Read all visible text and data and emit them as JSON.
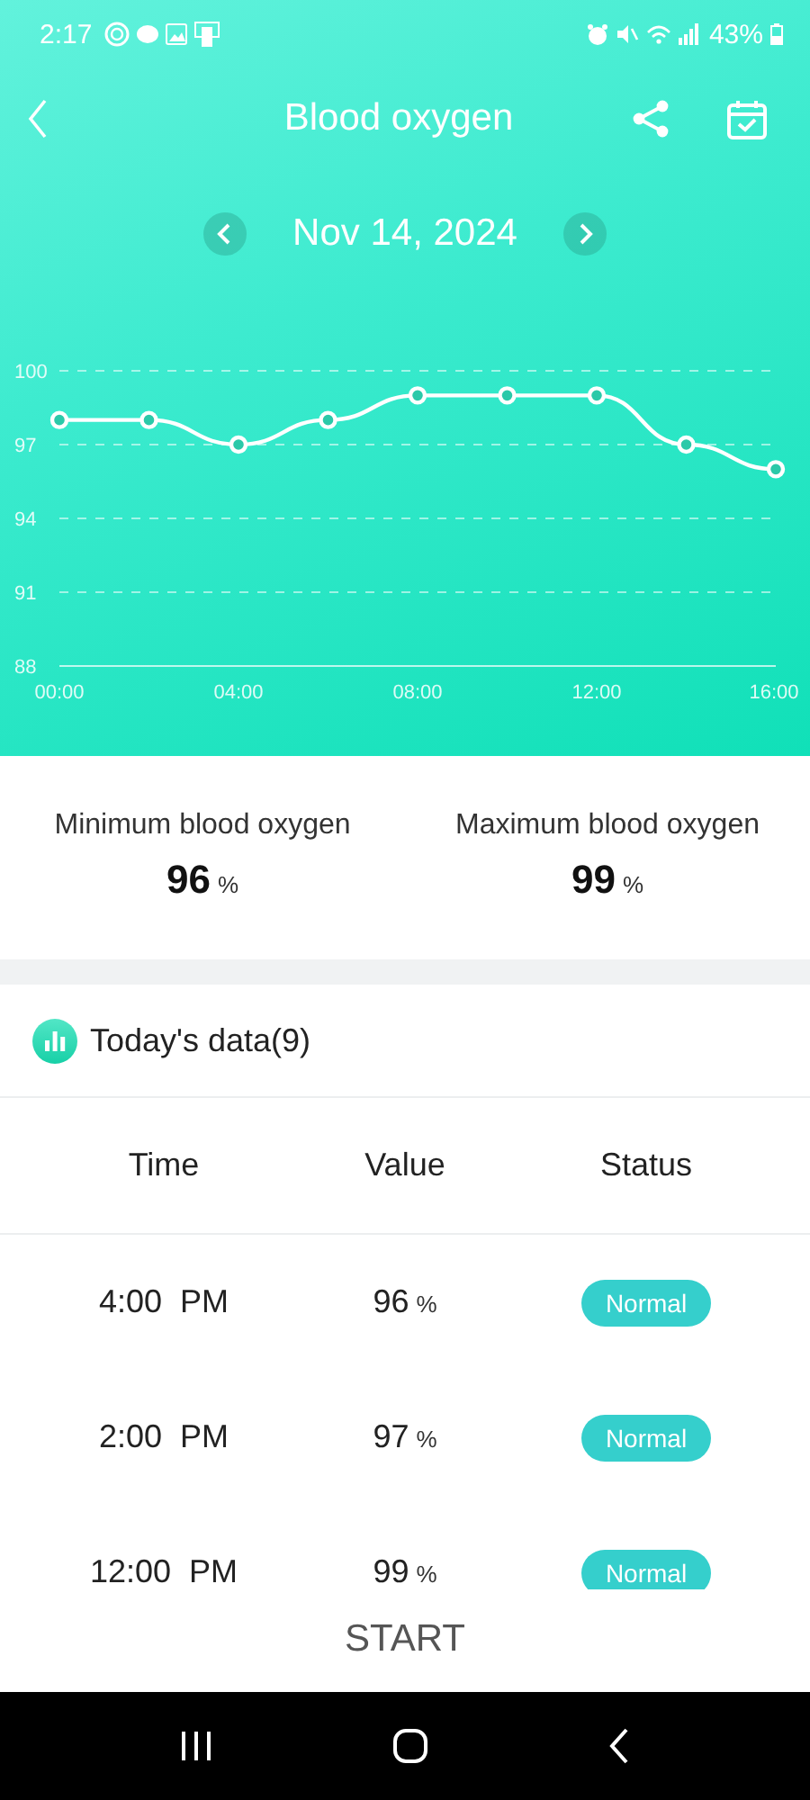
{
  "status_bar": {
    "time": "2:17",
    "battery": "43%"
  },
  "header": {
    "title": "Blood oxygen"
  },
  "date_nav": {
    "date": "Nov 14, 2024"
  },
  "chart": {
    "chart_data": {
      "type": "line",
      "x": [
        0,
        2,
        4,
        6,
        8,
        10,
        12,
        14,
        16
      ],
      "series": [
        {
          "color": "#ffffff",
          "marker": true,
          "values": [
            98,
            98,
            97,
            98,
            99,
            99,
            99,
            97,
            96
          ]
        }
      ],
      "grid": true,
      "xlim": [
        0,
        16
      ],
      "ylim": [
        88,
        100
      ],
      "xticks": [
        {
          "value": 0,
          "label": "00:00"
        },
        {
          "value": 4,
          "label": "04:00"
        },
        {
          "value": 8,
          "label": "08:00"
        },
        {
          "value": 12,
          "label": "12:00"
        },
        {
          "value": 16,
          "label": "16:00"
        }
      ],
      "yticks": [
        88,
        91,
        94,
        97,
        100
      ]
    }
  },
  "stats": [
    {
      "label": "Minimum blood oxygen",
      "value": "96",
      "unit": "%"
    },
    {
      "label": "Maximum blood oxygen",
      "value": "99",
      "unit": "%"
    }
  ],
  "today": {
    "title": "Today's data(9)",
    "columns": [
      "Time",
      "Value",
      "Status"
    ],
    "rows": [
      {
        "time": "4:00  PM",
        "value": "96",
        "unit": "%",
        "status": "Normal"
      },
      {
        "time": "2:00  PM",
        "value": "97",
        "unit": "%",
        "status": "Normal"
      },
      {
        "time": "12:00  PM",
        "value": "99",
        "unit": "%",
        "status": "Normal"
      }
    ]
  },
  "start_button": "START"
}
